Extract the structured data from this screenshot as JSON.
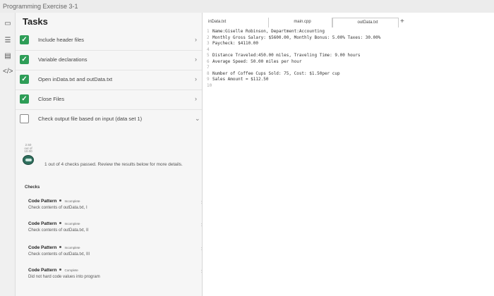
{
  "window": {
    "title": "Programming Exercise 3-1"
  },
  "rail": {
    "icons": [
      "panel-icon",
      "list-icon",
      "chart-icon",
      "code-icon"
    ]
  },
  "tasks": {
    "header": "Tasks",
    "items": [
      {
        "label": "Include header files",
        "done": true
      },
      {
        "label": "Variable declarations",
        "done": true
      },
      {
        "label": "Open inData.txt and outData.txt",
        "done": true
      },
      {
        "label": "Close Files",
        "done": true
      },
      {
        "label": "Check output file based on input (data set 1)",
        "done": false
      }
    ],
    "badge": [
      "2.50",
      "out of",
      "10.00"
    ],
    "summary": "1 out of 4 checks passed. Review the results below for more details."
  },
  "checks": {
    "title": "Checks",
    "items": [
      {
        "name": "Code Pattern",
        "status": "Incomplete",
        "description": "Check contents of outData.txt, I"
      },
      {
        "name": "Code Pattern",
        "status": "Incomplete",
        "description": "Check contents of outData.txt, II"
      },
      {
        "name": "Code Pattern",
        "status": "Incomplete",
        "description": "Check contents of outData.txt, III"
      },
      {
        "name": "Code Pattern",
        "status": "Complete",
        "description": "Did not hard code values into program"
      }
    ]
  },
  "editor": {
    "tabs": [
      "inData.txt",
      "main.cpp",
      "outData.txt"
    ],
    "active_tab": 2,
    "lines": [
      {
        "n": "1",
        "text": "Name:Giselle Robinson, Department:Accounting"
      },
      {
        "n": "2",
        "text": "Monthly Gross Salary: $5600.00, Monthly Bonus: 5.00% Taxes: 30.00%"
      },
      {
        "n": "3",
        "text": "Paycheck: $4110.00"
      },
      {
        "n": "4",
        "text": ""
      },
      {
        "n": "5",
        "text": "Distance Traveled:450.00 miles, Traveling Time: 9.00 hours"
      },
      {
        "n": "6",
        "text": "Average Speed: 50.00 miles per hour"
      },
      {
        "n": "7",
        "text": ""
      },
      {
        "n": "8",
        "text": "Number of Coffee Cups Sold: 75, Cost: $1.50per cup"
      },
      {
        "n": "9",
        "text": "Sales Amount = $112.50"
      },
      {
        "n": "10",
        "text": ""
      }
    ]
  }
}
